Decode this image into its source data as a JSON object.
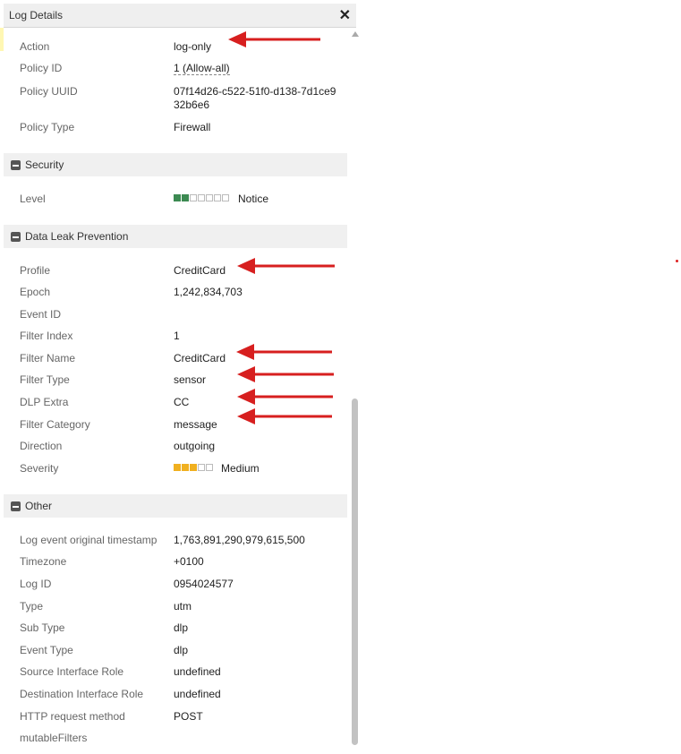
{
  "panel": {
    "title": "Log Details"
  },
  "general": [
    {
      "key": "Action",
      "value": "log-only"
    },
    {
      "key": "Policy ID",
      "value": "1 (Allow-all)"
    },
    {
      "key": "Policy UUID",
      "value": "07f14d26-c522-51f0-d138-7d1ce9",
      "value2": "32b6e6"
    },
    {
      "key": "Policy Type",
      "value": "Firewall"
    }
  ],
  "security": {
    "title": "Security",
    "level_key": "Level",
    "level_text": "Notice",
    "level_fraction": 0.29
  },
  "dlp": {
    "title": "Data Leak Prevention",
    "rows": [
      {
        "key": "Profile",
        "value": "CreditCard"
      },
      {
        "key": "Epoch",
        "value": "1,242,834,703"
      },
      {
        "key": "Event ID",
        "value": ""
      },
      {
        "key": "Filter Index",
        "value": "1"
      },
      {
        "key": "Filter Name",
        "value": "CreditCard"
      },
      {
        "key": "Filter Type",
        "value": "sensor"
      },
      {
        "key": "DLP Extra",
        "value": "CC"
      },
      {
        "key": "Filter Category",
        "value": "message"
      },
      {
        "key": "Direction",
        "value": "outgoing"
      }
    ],
    "severity_key": "Severity",
    "severity_text": "Medium",
    "severity_fraction": 0.6
  },
  "other": {
    "title": "Other",
    "rows": [
      {
        "key": "Log event original timestamp",
        "value": "1,763,891,290,979,615,500"
      },
      {
        "key": "Timezone",
        "value": "+0100"
      },
      {
        "key": "Log ID",
        "value": "0954024577"
      },
      {
        "key": "Type",
        "value": "utm"
      },
      {
        "key": "Sub Type",
        "value": "dlp"
      },
      {
        "key": "Event Type",
        "value": "dlp"
      },
      {
        "key": "Source Interface Role",
        "value": "undefined"
      },
      {
        "key": "Destination Interface Role",
        "value": "undefined"
      },
      {
        "key": "HTTP request method",
        "value": "POST"
      },
      {
        "key": "mutableFilters",
        "value": ""
      }
    ]
  },
  "colors": {
    "arrow": "#d71f1f",
    "level_green": "#3c8a52",
    "severity_yellow": "#f0b020"
  }
}
